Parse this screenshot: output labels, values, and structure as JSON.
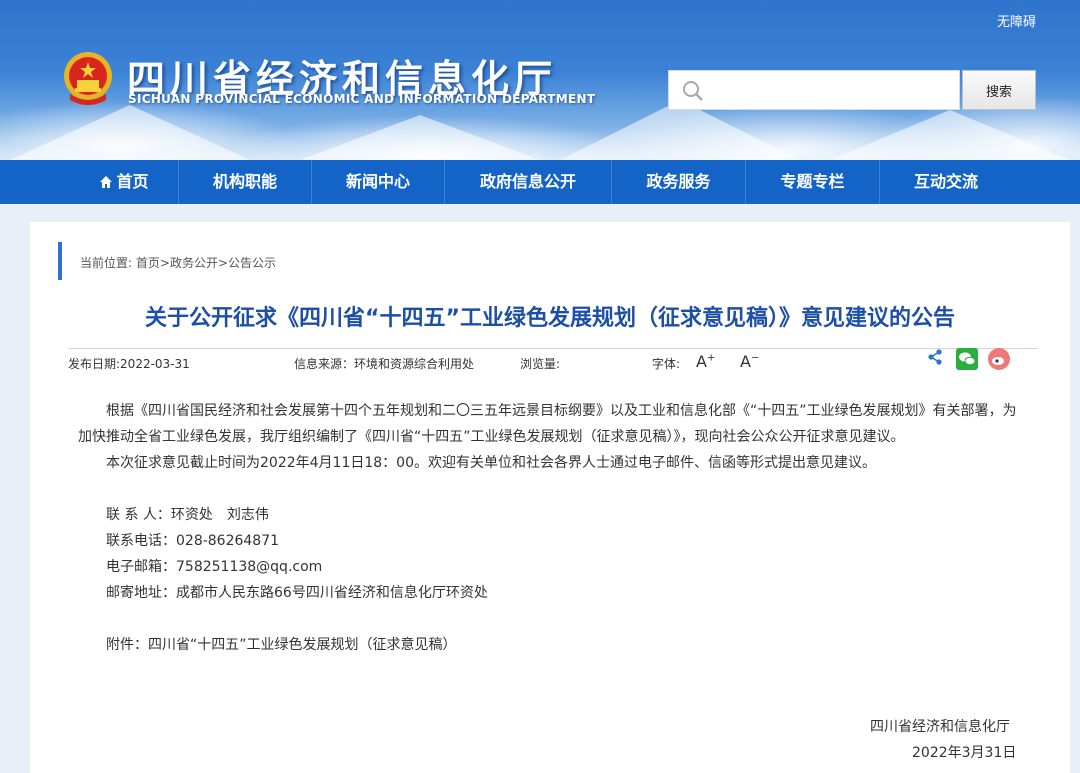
{
  "header": {
    "accessibility_label": "无障碍",
    "site_title": "四川省经济和信息化厅",
    "site_subtitle": "SICHUAN PROVINCIAL ECONOMIC AND INFORMATION DEPARTMENT",
    "search": {
      "placeholder": "",
      "value": "",
      "button_label": "搜索"
    },
    "colors": {
      "nav": "#1464c8",
      "title_blue": "#1c4fa5"
    }
  },
  "nav": {
    "items": [
      {
        "label": "首页",
        "icon": "home-icon"
      },
      {
        "label": "机构职能"
      },
      {
        "label": "新闻中心"
      },
      {
        "label": "政府信息公开"
      },
      {
        "label": "政务服务"
      },
      {
        "label": "专题专栏"
      },
      {
        "label": "互动交流"
      }
    ]
  },
  "breadcrumb": {
    "prefix": "当前位置: ",
    "items": [
      "首页",
      "政务公开",
      "公告公示"
    ],
    "separator": ">"
  },
  "article": {
    "title": "关于公开征求《四川省“十四五”工业绿色发展规划（征求意见稿）》意见建议的公告",
    "meta": {
      "publish_date": "发布日期:2022-03-31",
      "source": "信息来源：环境和资源综合利用处",
      "views": "浏览量:",
      "font_size_label": "字体:",
      "font_increase": "A",
      "font_decrease": "A",
      "share_icons": [
        "share-icon",
        "wechat-icon",
        "weibo-icon"
      ]
    },
    "paragraphs": [
      "根据《四川省国民经济和社会发展第十四个五年规划和二〇三五年远景目标纲要》以及工业和信息化部《“十四五”工业绿色发展规划》有关部署，为加快推动全省工业绿色发展，我厅组织编制了《四川省“十四五”工业绿色发展规划（征求意见稿）》，现向社会公众公开征求意见建议。",
      "本次征求意见截止时间为2022年4月11日18：00。欢迎有关单位和社会各界人士通过电子邮件、信函等形式提出意见建议。"
    ],
    "contacts": {
      "contact_person": "联 系 人：环资处　刘志伟",
      "phone": "联系电话：028-86264871",
      "email": "电子邮箱：758251138@qq.com",
      "address": "邮寄地址：成都市人民东路66号四川省经济和信息化厅环资处"
    },
    "attachment": "附件：四川省“十四五”工业绿色发展规划（征求意见稿）",
    "signature": {
      "org": "四川省经济和信息化厅",
      "date": "2022年3月31日"
    }
  }
}
